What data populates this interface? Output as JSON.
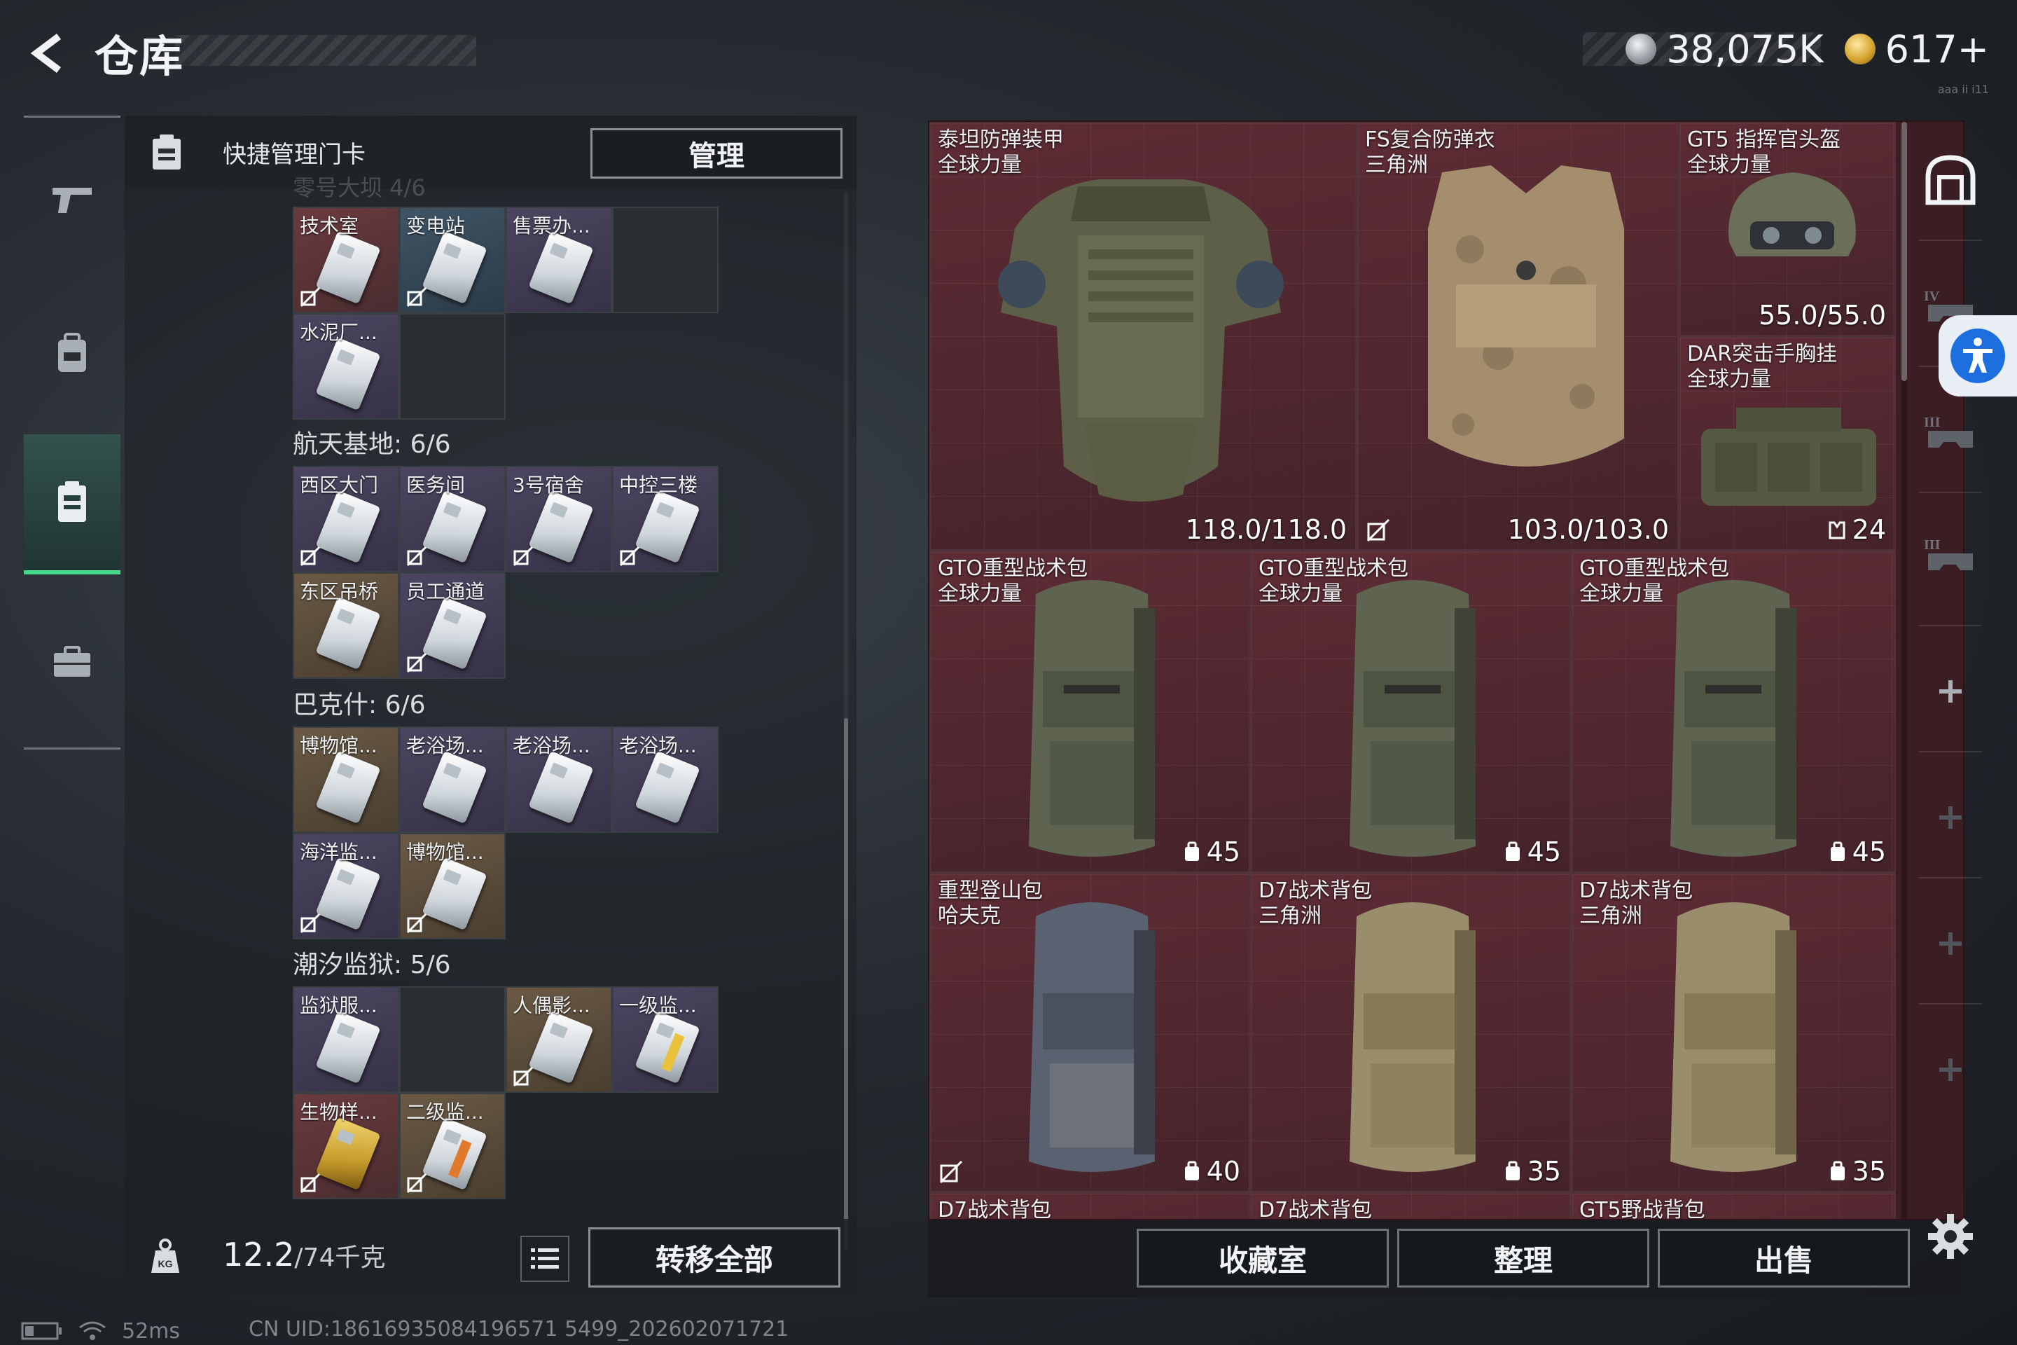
{
  "header": {
    "title": "仓库",
    "currency": [
      {
        "icon": "silver-coin-icon",
        "value": "38,075K"
      },
      {
        "icon": "gold-coin-icon",
        "value": "617+"
      }
    ],
    "version_mark": "aaa ii i11"
  },
  "left_nav": {
    "items": [
      {
        "name": "weapon",
        "icon": "pistol-icon"
      },
      {
        "name": "backpack",
        "icon": "backpack-icon"
      },
      {
        "name": "keycard",
        "icon": "keycard-icon",
        "active": true
      },
      {
        "name": "briefcase",
        "icon": "briefcase-icon"
      }
    ]
  },
  "keycard_panel": {
    "title": "快捷管理门卡",
    "manage_label": "管理",
    "ghost_group_label": "零号大坝 4/6",
    "groups": [
      {
        "label": "",
        "cards": [
          {
            "name": "技术室",
            "color": "red",
            "bound": true
          },
          {
            "name": "变电站",
            "color": "blue",
            "bound": true
          },
          {
            "name": "售票办...",
            "color": "purple",
            "bound": false
          },
          {
            "empty": true
          },
          {
            "name": "水泥厂...",
            "color": "purple",
            "bound": false
          },
          {
            "empty": true
          }
        ]
      },
      {
        "label": "航天基地: 6/6",
        "cards": [
          {
            "name": "西区大门",
            "color": "purple",
            "bound": true
          },
          {
            "name": "医务间",
            "color": "purple",
            "bound": true
          },
          {
            "name": "3号宿舍",
            "color": "purple",
            "bound": true
          },
          {
            "name": "中控三楼",
            "color": "purple",
            "bound": true
          },
          {
            "name": "东区吊桥",
            "color": "brown",
            "bound": false
          },
          {
            "name": "员工通道",
            "color": "purple",
            "bound": true
          }
        ]
      },
      {
        "label": "巴克什: 6/6",
        "cards": [
          {
            "name": "博物馆...",
            "color": "brown",
            "bound": false
          },
          {
            "name": "老浴场...",
            "color": "purple",
            "bound": false
          },
          {
            "name": "老浴场...",
            "color": "purple",
            "bound": false
          },
          {
            "name": "老浴场...",
            "color": "purple",
            "bound": false
          },
          {
            "name": "海洋监...",
            "color": "purple",
            "bound": true
          },
          {
            "name": "博物馆...",
            "color": "brown",
            "bound": true
          }
        ]
      },
      {
        "label": "潮汐监狱: 5/6",
        "cards": [
          {
            "name": "监狱服...",
            "color": "purple",
            "bound": false
          },
          {
            "empty": true
          },
          {
            "name": "人偶影...",
            "color": "brown",
            "bound": true
          },
          {
            "name": "一级监...",
            "color": "purple",
            "bound": false,
            "stripe": "yellow"
          },
          {
            "name": "生物样...",
            "color": "red",
            "bound": true,
            "gold": true
          },
          {
            "name": "二级监...",
            "color": "brown",
            "bound": true,
            "stripe": "orange"
          }
        ]
      }
    ],
    "weight_current": "12.2",
    "weight_capacity": "/74千克",
    "transfer_all_label": "转移全部"
  },
  "stash": {
    "items": [
      {
        "name": "泰坦防弹装甲",
        "sub": "全球力量",
        "value": "118.0/118.0",
        "type": "armor-dark"
      },
      {
        "name": "FS复合防弹衣",
        "sub": "三角洲",
        "value": "103.0/103.0",
        "type": "armor-camo",
        "bound": true
      },
      {
        "name": "GT5 指挥官头盔",
        "sub": "全球力量",
        "value": "55.0/55.0",
        "type": "helmet"
      },
      {
        "name": "DAR突击手胸挂",
        "sub": "全球力量",
        "value": "24",
        "type": "rig",
        "value_icon": "rig-capacity-icon"
      },
      {
        "name": "GTO重型战术包",
        "sub": "全球力量",
        "value": "45",
        "type": "pack-green",
        "value_icon": "backpack-capacity-icon"
      },
      {
        "name": "GTO重型战术包",
        "sub": "全球力量",
        "value": "45",
        "type": "pack-green",
        "value_icon": "backpack-capacity-icon"
      },
      {
        "name": "GTO重型战术包",
        "sub": "全球力量",
        "value": "45",
        "type": "pack-green",
        "value_icon": "backpack-capacity-icon"
      },
      {
        "name": "重型登山包",
        "sub": "哈夫克",
        "value": "40",
        "type": "pack-gray",
        "bound": true,
        "value_icon": "backpack-capacity-icon"
      },
      {
        "name": "D7战术背包",
        "sub": "三角洲",
        "value": "35",
        "type": "pack-tan",
        "value_icon": "backpack-capacity-icon"
      },
      {
        "name": "D7战术背包",
        "sub": "三角洲",
        "value": "35",
        "type": "pack-tan",
        "value_icon": "backpack-capacity-icon"
      },
      {
        "name": "D7战术背包",
        "sub": "",
        "value": "",
        "type": "partial"
      },
      {
        "name": "D7战术背包",
        "sub": "",
        "value": "",
        "type": "partial"
      },
      {
        "name": "GT5野战背包",
        "sub": "",
        "value": "",
        "type": "partial"
      }
    ],
    "buttons": {
      "collection": "收藏室",
      "organize": "整理",
      "sell": "出售"
    }
  },
  "right_bar": {
    "items": [
      "helmet-slot-icon",
      "armor-level-IV-icon",
      "armor-level-III-icon",
      "armor-level-III-icon",
      "add-slot-icon",
      "add-slot-icon",
      "add-slot-icon",
      "add-slot-icon"
    ]
  },
  "status": {
    "ping": "52ms",
    "uid": "CN UID:18616935084196571 5499_202602071721"
  },
  "colors": {
    "stash_bg": "#45232a",
    "active_nav": "#46d98a",
    "accessibility": "#1d6fe0"
  }
}
